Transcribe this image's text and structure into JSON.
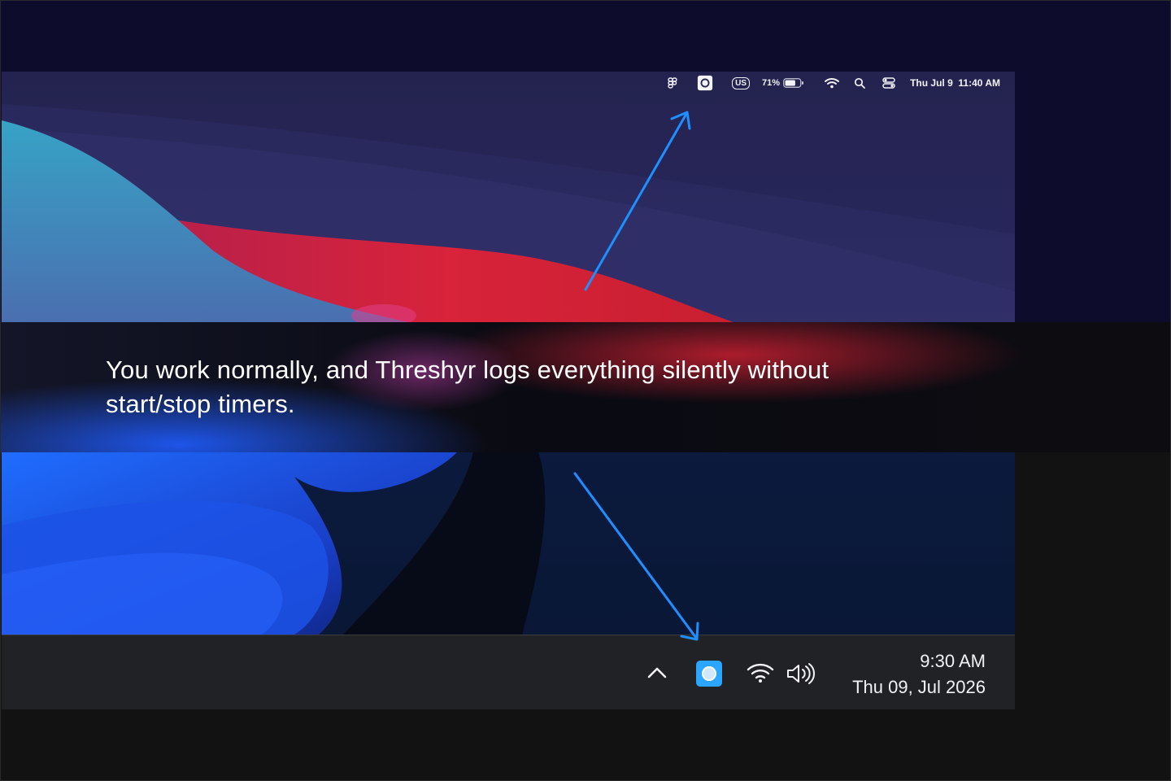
{
  "caption": {
    "text": "You work normally, and Threshyr logs everything silently without start/stop timers."
  },
  "mac_menubar": {
    "items": [
      {
        "icon": "figma-icon"
      },
      {
        "icon": "threshyr-icon",
        "highlighted": true
      },
      {
        "icon": "keyboard-us-icon",
        "label": "US"
      },
      {
        "label": "71%"
      },
      {
        "icon": "battery-icon",
        "level": 0.71
      },
      {
        "icon": "wifi-icon"
      },
      {
        "icon": "search-icon"
      },
      {
        "icon": "control-center-icon"
      }
    ],
    "clock": "Thu Jul 9  11:40 AM"
  },
  "win_taskbar": {
    "items": [
      {
        "icon": "chevron-up-icon"
      },
      {
        "icon": "threshyr-icon",
        "highlighted": true
      },
      {
        "icon": "wifi-icon"
      },
      {
        "icon": "speaker-icon"
      }
    ],
    "time": "9:30 AM",
    "date": "Thu 09, Jul 2026"
  },
  "colors": {
    "arrow": "#1e8fff",
    "accent_blue": "#2aa6ff",
    "mac_red": "#d0233a",
    "mac_teal": "#3aa2c4"
  }
}
